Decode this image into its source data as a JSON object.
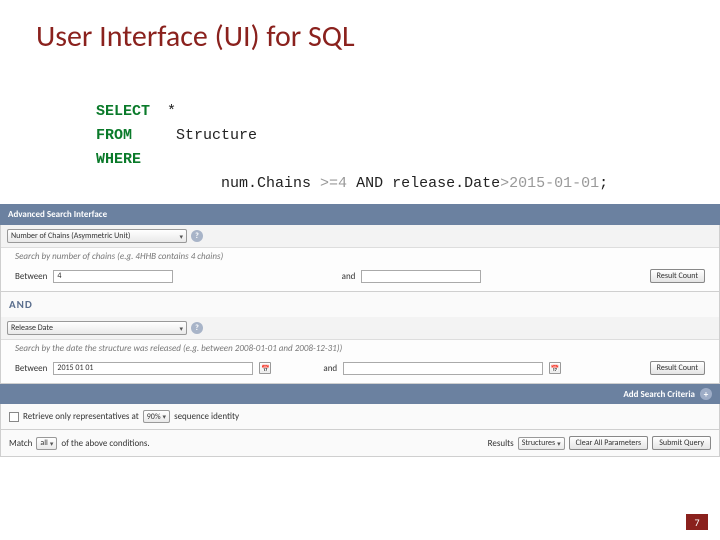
{
  "title": "User Interface (UI) for SQL",
  "sql": {
    "select_kw": "SELECT",
    "select_body": " *",
    "from_kw": "FROM",
    "from_body": "  Structure",
    "where_kw": "WHERE",
    "where_field1": " num.Chains ",
    "where_op1": ">=4",
    "where_and": " AND ",
    "where_field2": "release.Date",
    "where_op2": ">",
    "where_val2": "2015-01-01",
    "where_end": ";"
  },
  "ui": {
    "adv_header": "Advanced Search Interface",
    "crit1": {
      "dropdown": "Number of Chains (Asymmetric Unit)",
      "desc": "Search by number of chains (e.g. 4HHB contains 4 chains)",
      "between": "Between",
      "val_from": "4",
      "and": "and",
      "val_to": "",
      "result_btn": "Result Count"
    },
    "and_sep": "AND",
    "crit2": {
      "dropdown": "Release Date",
      "desc": "Search by the date the structure was released (e.g. between 2008-01-01 and 2008-12-31))",
      "between": "Between",
      "val_from": "2015 01 01",
      "and": "and",
      "val_to": "",
      "result_btn": "Result Count"
    },
    "add_criteria": "Add Search Criteria",
    "footer": {
      "retrieve_text_a": "Retrieve only representatives at",
      "identity_dd": "90%",
      "retrieve_text_b": "sequence identity",
      "match_a": "Match",
      "match_dd": "all",
      "match_b": "of the above conditions.",
      "results_label": "Results",
      "results_dd": "Structures",
      "clear_btn": "Clear All Parameters",
      "submit_btn": "Submit Query"
    }
  },
  "page_number": "7"
}
